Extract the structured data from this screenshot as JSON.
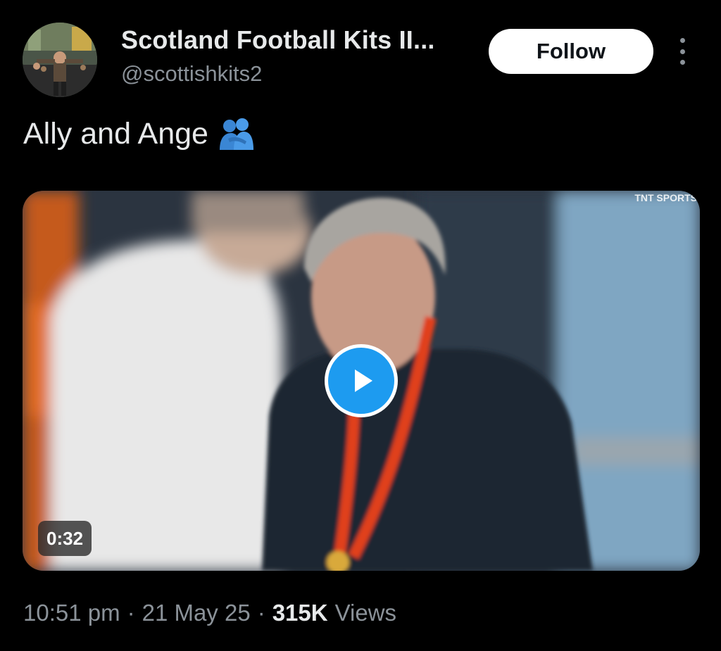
{
  "author": {
    "display_name": "Scotland Football Kits II...",
    "handle": "@scottishkits2",
    "avatar_icon": "profile-photo"
  },
  "actions": {
    "follow_label": "Follow",
    "more_icon": "more-vertical-icon"
  },
  "tweet": {
    "text": "Ally and Ange",
    "emoji": "people-hugging-emoji"
  },
  "media": {
    "type": "video",
    "broadcaster": "TNT SPORTS",
    "duration": "0:32",
    "play_icon": "play-icon"
  },
  "meta": {
    "time": "10:51 pm",
    "separator": "·",
    "date": "21 May 25",
    "views_count": "315K",
    "views_label": "Views"
  },
  "colors": {
    "background": "#000000",
    "text_primary": "#e7e9ea",
    "text_secondary": "#8b9299",
    "accent": "#1d9bf0",
    "follow_bg": "#ffffff"
  }
}
